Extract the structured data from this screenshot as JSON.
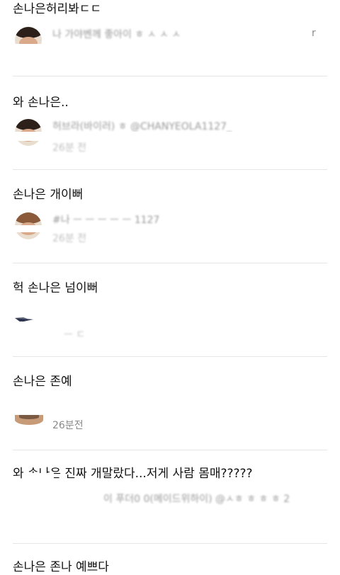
{
  "comments": [
    {
      "text": "손나은허리봐ㄷㄷ",
      "author": "나 가야벤께 좋아이 ㅎ ㅅ ㅅ ㅅ",
      "time": "",
      "stray": "r"
    },
    {
      "text": "와 손나은..",
      "author": "허브라(바이러) ㅎ @CHANYEOLA1127_",
      "time": "26분 전"
    },
    {
      "text": "손나은 개이뻐",
      "author": "#나 ㅡ ㅡ ㅡ ㅡ ㅡ 1127",
      "time": "26분 전"
    },
    {
      "text": "헉 손나은 넘이뻐",
      "author": "",
      "time": "ㅡ ㄷ"
    },
    {
      "text": "손나은 존예",
      "author": "",
      "time": "26분전"
    },
    {
      "text": "와 손나은 진짜 개말랐다...저게 사람 몸매?????",
      "author": "이 푸더0 0(메이드위하이) @ㅅㅎ ㅎ ㅎ ㅎ 2",
      "time": ""
    },
    {
      "text": "손나은 존나 예쁘다",
      "author": "",
      "time": ""
    }
  ],
  "colors": {
    "text": "#111111",
    "meta": "#8a8a8a",
    "divider": "#e6e6e6",
    "background": "#ffffff"
  }
}
